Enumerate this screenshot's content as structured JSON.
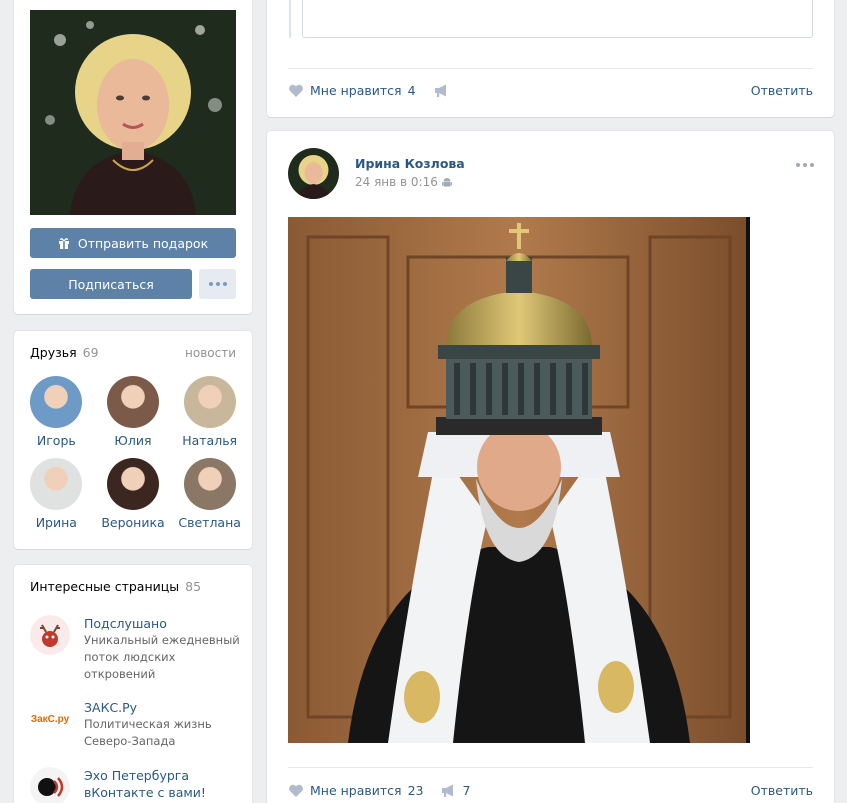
{
  "profile": {
    "gift_button": "Отправить подарок",
    "subscribe_button": "Подписаться",
    "photo_icon": "person-photo"
  },
  "friends": {
    "title": "Друзья",
    "count": "69",
    "news_link": "новости",
    "items": [
      {
        "name": "Игорь",
        "avatar_color": "#6d9ac7"
      },
      {
        "name": "Юлия",
        "avatar_color": "#7c5a4a"
      },
      {
        "name": "Наталья",
        "avatar_color": "#c8b79a"
      },
      {
        "name": "Ирина",
        "avatar_color": "#dfe2e0"
      },
      {
        "name": "Вероника",
        "avatar_color": "#3b2620"
      },
      {
        "name": "Светлана",
        "avatar_color": "#8a7766"
      }
    ]
  },
  "pages": {
    "title": "Интересные страницы",
    "count": "85",
    "items": [
      {
        "name": "Подслушано",
        "desc": [
          "Уникальный ежедневный",
          "поток людских",
          "откровений"
        ],
        "icon": "reindeer-icon"
      },
      {
        "name": "ЗАКС.Ру",
        "desc": [
          "Политическая жизнь",
          "Северо-Запада"
        ],
        "icon": "zaks-logo",
        "logo_text": "ЗакС.ру"
      },
      {
        "name": "Эхо Петербурга",
        "desc": [
          "вКонтакте с вами!"
        ],
        "icon": "echo-logo"
      }
    ]
  },
  "post1": {
    "like_label": "Мне нравится",
    "like_count": "4",
    "reply_label": "Ответить"
  },
  "post2": {
    "author": "Ирина Козлова",
    "date": "24 янв в 0:16",
    "like_label": "Мне нравится",
    "like_count": "23",
    "share_count": "7",
    "reply_label": "Ответить"
  },
  "colors": {
    "link": "#2a5885",
    "button": "#5e81a8",
    "page_bg": "#edeef0",
    "muted": "#939393"
  }
}
